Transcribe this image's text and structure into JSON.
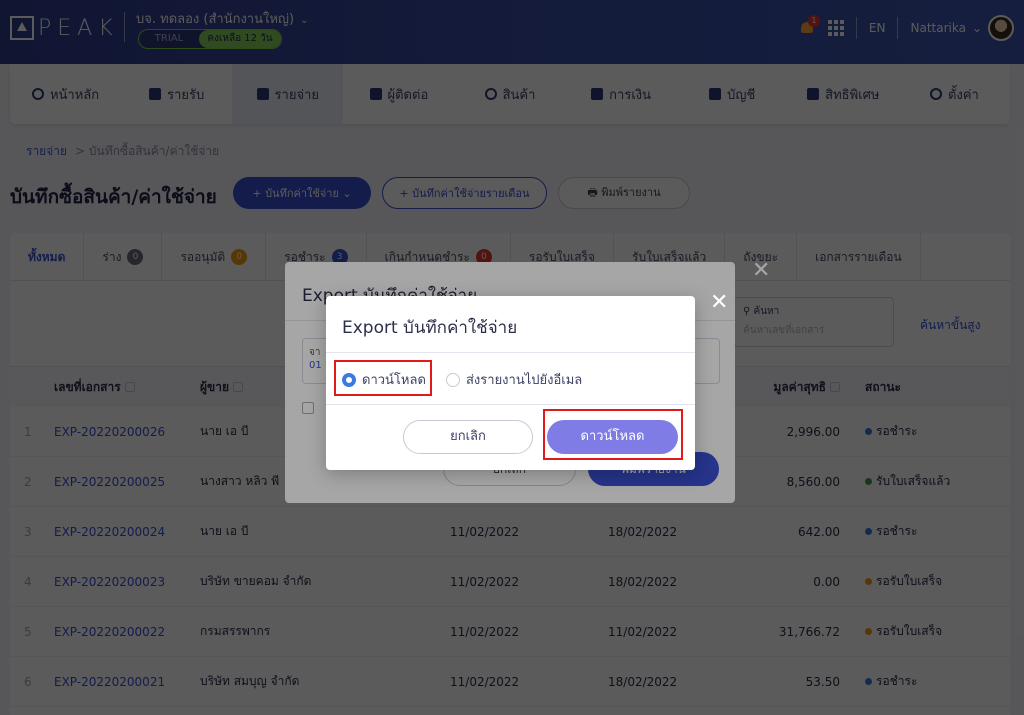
{
  "header": {
    "logo_text": "PEAK",
    "company": "บจ. ทดลอง (สำนักงานใหญ่)",
    "trial_label": "TRIAL",
    "trial_remaining": "คงเหลือ 12 วัน",
    "notification_count": "1",
    "language": "EN",
    "user_name": "Nattarika"
  },
  "nav": {
    "items": [
      {
        "label": "หน้าหลัก",
        "icon": "home-icon"
      },
      {
        "label": "รายรับ",
        "icon": "income-icon"
      },
      {
        "label": "รายจ่าย",
        "icon": "expense-icon"
      },
      {
        "label": "ผู้ติดต่อ",
        "icon": "contact-icon"
      },
      {
        "label": "สินค้า",
        "icon": "product-icon"
      },
      {
        "label": "การเงิน",
        "icon": "finance-icon"
      },
      {
        "label": "บัญชี",
        "icon": "account-icon"
      },
      {
        "label": "สิทธิพิเศษ",
        "icon": "privilege-icon"
      },
      {
        "label": "ตั้งค่า",
        "icon": "settings-icon"
      }
    ]
  },
  "breadcrumb": {
    "root": "รายจ่าย",
    "current": "> บันทึกซื้อสินค้า/ค่าใช้จ่าย"
  },
  "page": {
    "title": "บันทึกซื้อสินค้า/ค่าใช้จ่าย",
    "btn_new": "+ บันทึกค่าใช้จ่าย ⌄",
    "btn_monthly": "+ บันทึกค่าใช้จ่ายรายเดือน",
    "btn_print": "🖶 พิมพ์รายงาน"
  },
  "tabs": [
    {
      "label": "ทั้งหมด",
      "count": ""
    },
    {
      "label": "ร่าง",
      "count": "0"
    },
    {
      "label": "รออนุมัติ",
      "count": "0"
    },
    {
      "label": "รอชำระ",
      "count": "3"
    },
    {
      "label": "เกินกำหนดชำระ",
      "count": "0"
    },
    {
      "label": "รอรับใบเสร็จ",
      "count": ""
    },
    {
      "label": "รับใบเสร็จแล้ว",
      "count": ""
    },
    {
      "label": "ถังขยะ",
      "count": ""
    },
    {
      "label": "เอกสารรายเดือน",
      "count": ""
    }
  ],
  "search": {
    "label": "ค้นหา",
    "placeholder": "ค้นหาเลขที่เอกสาร",
    "advanced": "ค้นหาขั้นสูง"
  },
  "table": {
    "headers": {
      "doc": "เลขที่เอกสาร",
      "vendor": "ผู้ขาย",
      "net": "มูลค่าสุทธิ",
      "status": "สถานะ"
    },
    "rows": [
      {
        "idx": "1",
        "doc": "EXP-20220200026",
        "vendor": "นาย เอ บี",
        "date1": "",
        "date2": "",
        "amount": "2,996.00",
        "status": "รอชำระ",
        "status_color": "#3b7be0"
      },
      {
        "idx": "2",
        "doc": "EXP-20220200025",
        "vendor": "นางสาว หลิว พี",
        "date1": "",
        "date2": "",
        "amount": "8,560.00",
        "status": "รับใบเสร็จแล้ว",
        "status_color": "#43a047"
      },
      {
        "idx": "3",
        "doc": "EXP-20220200024",
        "vendor": "นาย เอ บี",
        "date1": "11/02/2022",
        "date2": "18/02/2022",
        "amount": "642.00",
        "status": "รอชำระ",
        "status_color": "#3b7be0"
      },
      {
        "idx": "4",
        "doc": "EXP-20220200023",
        "vendor": "บริษัท ขายคอม จำกัด",
        "date1": "11/02/2022",
        "date2": "18/02/2022",
        "amount": "0.00",
        "status": "รอรับใบเสร็จ",
        "status_color": "#f39c12"
      },
      {
        "idx": "5",
        "doc": "EXP-20220200022",
        "vendor": "กรมสรรพากร",
        "date1": "11/02/2022",
        "date2": "11/02/2022",
        "amount": "31,766.72",
        "status": "รอรับใบเสร็จ",
        "status_color": "#f39c12"
      },
      {
        "idx": "6",
        "doc": "EXP-20220200021",
        "vendor": "บริษัท สมบุญ จำกัด",
        "date1": "11/02/2022",
        "date2": "18/02/2022",
        "amount": "53.50",
        "status": "รอชำระ",
        "status_color": "#3b7be0"
      }
    ]
  },
  "back_modal": {
    "title": "Export บันทึกค่าใช้จ่าย",
    "field_label": "จา",
    "field_value": "01",
    "cancel": "ยกเลิก",
    "ok": "พิมพ์รายงาน"
  },
  "modal": {
    "title": "Export บันทึกค่าใช้จ่าย",
    "option_download": "ดาวน์โหลด",
    "option_email": "ส่งรายงานไปยังอีเมล",
    "cancel": "ยกเลิก",
    "download": "ดาวน์โหลด",
    "close": "✕"
  }
}
